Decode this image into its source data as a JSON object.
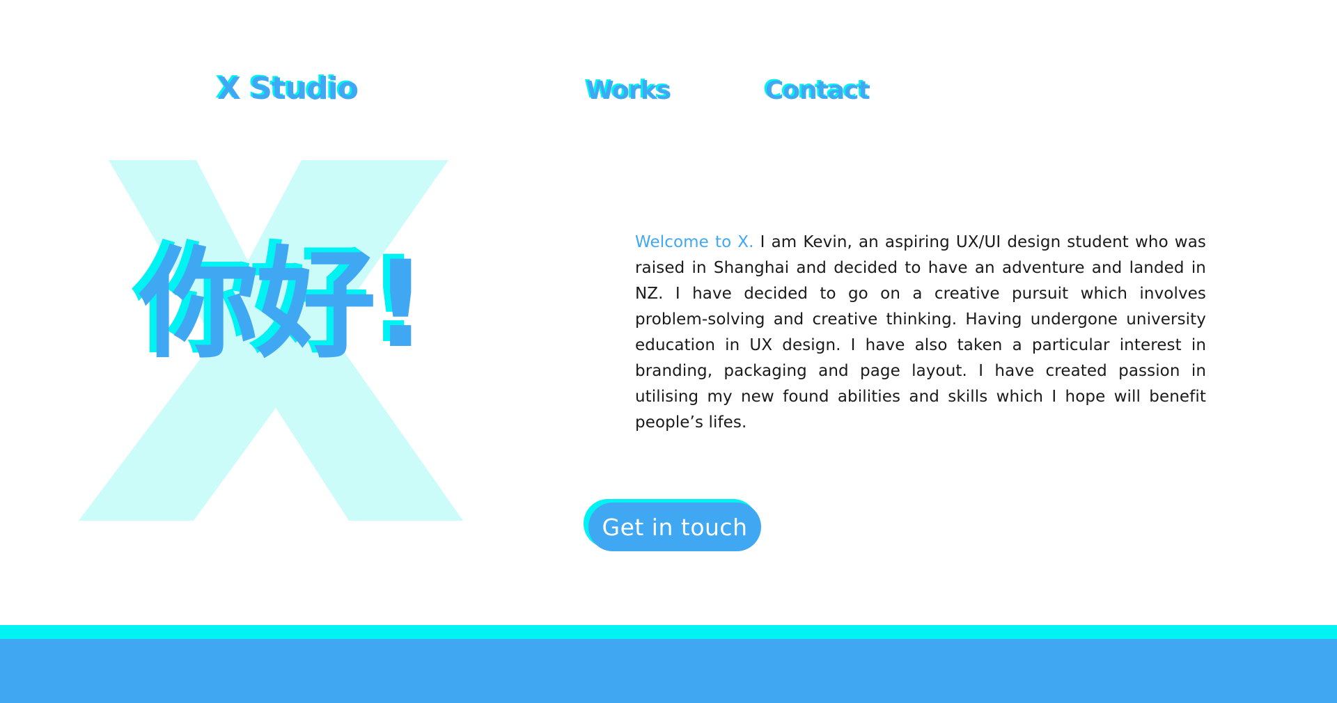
{
  "nav": {
    "brand": "X Studio",
    "links": [
      {
        "label": "Works"
      },
      {
        "label": "Contact"
      }
    ]
  },
  "hero": {
    "big_letter_icon": "x-letter-graphic",
    "greeting": "你好!",
    "intro_highlight": "Welcome to X.",
    "intro_text": " I am Kevin, an aspiring UX/UI design student who was raised in Shanghai and decided to have an adventure and landed in NZ. I have decided to go on a creative pursuit which involves problem-solving and creative thinking. Having undergone university education in UX design. I have also taken a particular interest in branding, packaging and page layout. I have created passion in utilising my new found abilities and skills which I hope will benefit people’s lifes.",
    "cta_label": "Get in touch"
  },
  "colors": {
    "primary_blue": "#40a8f2",
    "accent_cyan": "#00f2f2",
    "x_tint": "#ccfcfa",
    "background": "#ffffff",
    "body_text": "#1a1a1a"
  }
}
